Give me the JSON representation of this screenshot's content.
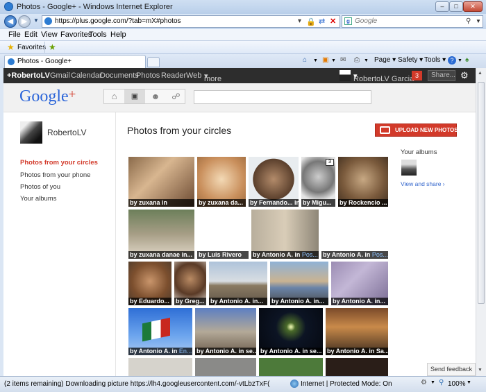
{
  "window": {
    "title": "Photos - Google+ - Windows Internet Explorer"
  },
  "address": {
    "url": "https://plus.google.com/?tab=mX#photos",
    "search_placeholder": "Google"
  },
  "menu": [
    "File",
    "Edit",
    "View",
    "Favorites",
    "Tools",
    "Help"
  ],
  "favorites_label": "Favorites",
  "tab": {
    "title": "Photos - Google+"
  },
  "commands": {
    "page": "Page",
    "safety": "Safety",
    "tools": "Tools"
  },
  "gbar": {
    "items": [
      "+RobertoLV",
      "Gmail",
      "Calendar",
      "Documents",
      "Photos",
      "Reader",
      "Web",
      "more"
    ],
    "user": "RobertoLV Garcia",
    "notifications": "3",
    "share": "Share..."
  },
  "logo": {
    "text": "Google",
    "plus": "+"
  },
  "profile": {
    "name": "RobertoLV"
  },
  "leftnav": [
    "Photos from your circles",
    "Photos from your phone",
    "Photos of you",
    "Your albums"
  ],
  "page_title": "Photos from your circles",
  "upload_label": "UPLOAD NEW PHOTOS",
  "albums": {
    "heading": "Your albums",
    "link": "View and share ›"
  },
  "photos": [
    {
      "by": "by ",
      "name": "zuxana",
      "in": " in"
    },
    {
      "by": "by ",
      "name": "zuxana da...",
      "in": ""
    },
    {
      "by": "by ",
      "name": "Fernando...",
      "in": " in"
    },
    {
      "by": "by ",
      "name": "Migu...",
      "in": ""
    },
    {
      "by": "by ",
      "name": "Rockencio ...",
      "in": ""
    },
    {
      "by": "by ",
      "name": "zuxana danae",
      "in": " in..."
    },
    {
      "by": "by ",
      "name": "Luis Rivero",
      "in": ""
    },
    {
      "by": "by ",
      "name": "Antonio A.",
      "in": " in ",
      "place": "Pos..."
    },
    {
      "by": "by ",
      "name": "Antonio A.",
      "in": " in ",
      "place": "Pos..."
    },
    {
      "by": "by ",
      "name": "Eduardo...",
      "in": ""
    },
    {
      "by": "by ",
      "name": "Greg...",
      "in": ""
    },
    {
      "by": "by ",
      "name": "Antonio A.",
      "in": " in..."
    },
    {
      "by": "by ",
      "name": "Antonio A.",
      "in": " in..."
    },
    {
      "by": "by ",
      "name": "Antonio A.",
      "in": " in..."
    },
    {
      "by": "by ",
      "name": "Antonio A.",
      "in": " in ",
      "place": "En..."
    },
    {
      "by": "by ",
      "name": "Antonio A.",
      "in": " in se..."
    },
    {
      "by": "by ",
      "name": "Antonio A.",
      "in": " in se..."
    },
    {
      "by": "by ",
      "name": "Antonio A.",
      "in": " in Sa..."
    }
  ],
  "photo_badge": "3",
  "send_feedback": "Send feedback",
  "status": {
    "text": "(2 items remaining) Downloading picture https://lh4.googleusercontent.com/-vtLbzTxF(",
    "zone": "Internet | Protected Mode: On",
    "zoom": "100%"
  }
}
